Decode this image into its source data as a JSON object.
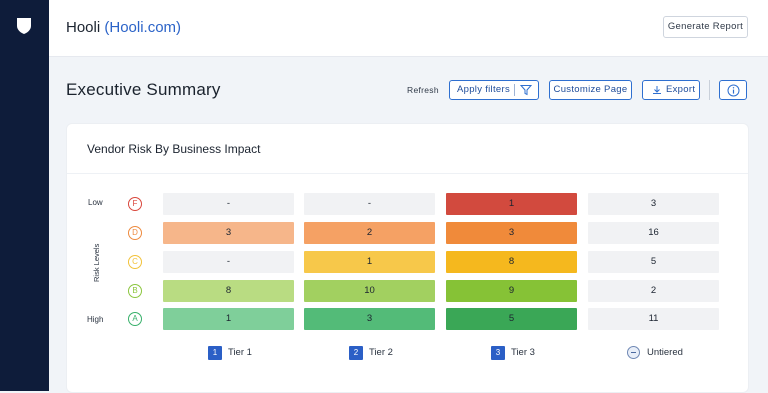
{
  "sidebar": {
    "logo_icon": "shield-icon"
  },
  "header": {
    "company_name": "Hooli",
    "company_domain": "Hooli.com",
    "generate_report_label": "Generate Report"
  },
  "page": {
    "title": "Executive Summary",
    "refresh_label": "Refresh",
    "apply_filters_label": "Apply filters",
    "customize_label": "Customize Page",
    "export_label": "Export"
  },
  "widget": {
    "title": "Vendor Risk By Business Impact",
    "axis_label": "Risk Levels",
    "row_labels": {
      "low": "Low",
      "high": "High"
    },
    "levels": [
      {
        "grade": "F",
        "color": "#d9473c",
        "cells": [
          "-",
          "-",
          "1",
          "3"
        ]
      },
      {
        "grade": "D",
        "color": "#ee8a3e",
        "cells": [
          "3",
          "2",
          "3",
          "16"
        ]
      },
      {
        "grade": "C",
        "color": "#f2c23a",
        "cells": [
          "-",
          "1",
          "8",
          "5"
        ]
      },
      {
        "grade": "B",
        "color": "#8cc63f",
        "cells": [
          "8",
          "10",
          "9",
          "2"
        ]
      },
      {
        "grade": "A",
        "color": "#37b06a",
        "cells": [
          "1",
          "3",
          "5",
          "11"
        ]
      }
    ],
    "tiers": [
      {
        "badge": "1",
        "label": "Tier 1"
      },
      {
        "badge": "2",
        "label": "Tier 2"
      },
      {
        "badge": "3",
        "label": "Tier 3"
      },
      {
        "badge": "",
        "label": "Untiered"
      }
    ],
    "cell_colors": [
      [
        "#f1f2f4",
        "#f1f2f4",
        "#d24a3e",
        "#f1f2f4"
      ],
      [
        "#f6b68a",
        "#f5a164",
        "#f08a3a",
        "#f1f2f4"
      ],
      [
        "#f1f2f4",
        "#f7c84a",
        "#f5b81e",
        "#f1f2f4"
      ],
      [
        "#b9dc82",
        "#a2d060",
        "#86c236",
        "#f1f2f4"
      ],
      [
        "#7fcf9a",
        "#53bb78",
        "#3aa756",
        "#f1f2f4"
      ]
    ]
  }
}
